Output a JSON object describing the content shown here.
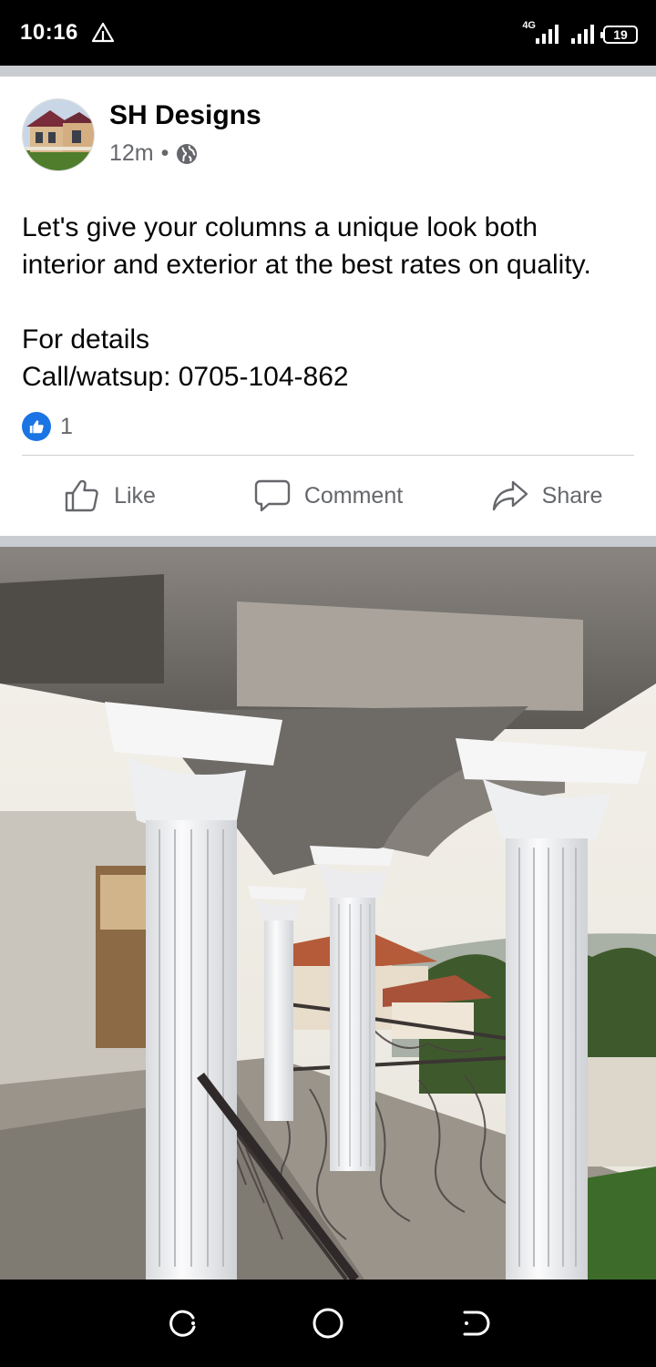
{
  "status_bar": {
    "time": "10:16",
    "network": "4G",
    "battery": "19"
  },
  "post": {
    "author": "SH Designs",
    "time_ago": "12m",
    "separator": "•",
    "text_lines": [
      "Let's give your columns a unique look both",
      "interior and exterior at the best rates on quality."
    ],
    "text_lines_2": [
      "For details",
      "Call/watsup: 0705-104-862"
    ],
    "reaction_count": "1"
  },
  "actions": {
    "like": "Like",
    "comment": "Comment",
    "share": "Share"
  },
  "colors": {
    "facebook_blue": "#1b74e4",
    "secondary_text": "#65676b",
    "divider": "#c9ccd1"
  },
  "icons": {
    "status_warning": "warning-triangle-icon",
    "globe": "globe-icon",
    "like_badge": "thumbs-up-icon",
    "like": "thumbs-up-outline-icon",
    "comment": "speech-bubble-icon",
    "share": "share-arrow-icon",
    "nav_recents": "recents-icon",
    "nav_home": "home-circle-icon",
    "nav_back": "back-icon"
  }
}
